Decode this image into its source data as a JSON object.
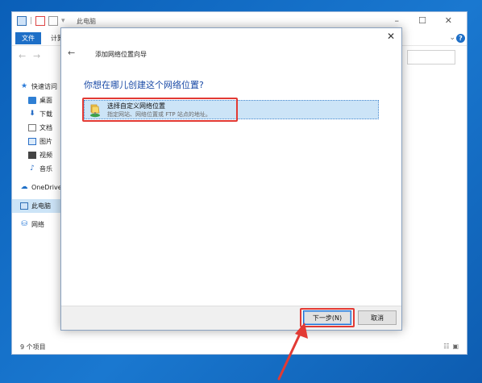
{
  "explorer": {
    "title": "此电脑",
    "file_tab": "文件",
    "ribbon_tab": "计算",
    "window_controls": {
      "minimize": "–",
      "maximize": "☐",
      "close": "✕"
    },
    "help": "?",
    "nav": {
      "back": "←",
      "forward": "→"
    },
    "sidebar": [
      {
        "label": "快速访问",
        "icon": "star-icon"
      },
      {
        "label": "桌面",
        "icon": "desktop-icon"
      },
      {
        "label": "下载",
        "icon": "download-icon"
      },
      {
        "label": "文档",
        "icon": "document-icon"
      },
      {
        "label": "图片",
        "icon": "pictures-icon"
      },
      {
        "label": "视频",
        "icon": "video-icon"
      },
      {
        "label": "音乐",
        "icon": "music-icon"
      },
      {
        "label": "OneDrive",
        "icon": "cloud-icon"
      },
      {
        "label": "此电脑",
        "icon": "computer-icon",
        "selected": true
      },
      {
        "label": "网络",
        "icon": "network-icon"
      }
    ],
    "status": "9 个项目"
  },
  "dialog": {
    "title": "添加网络位置向导",
    "close": "✕",
    "back": "←",
    "heading": "你想在哪儿创建这个网络位置?",
    "option": {
      "label": "选择自定义网络位置",
      "description": "指定网站、网络位置或 FTP 站点的地址。",
      "selected": true
    },
    "buttons": {
      "next": "下一步(N)",
      "cancel": "取消"
    }
  },
  "colors": {
    "accent": "#1e6fc7",
    "highlight": "#e23a34",
    "selection": "#cce4f7",
    "desktop": "#1a78d0"
  }
}
